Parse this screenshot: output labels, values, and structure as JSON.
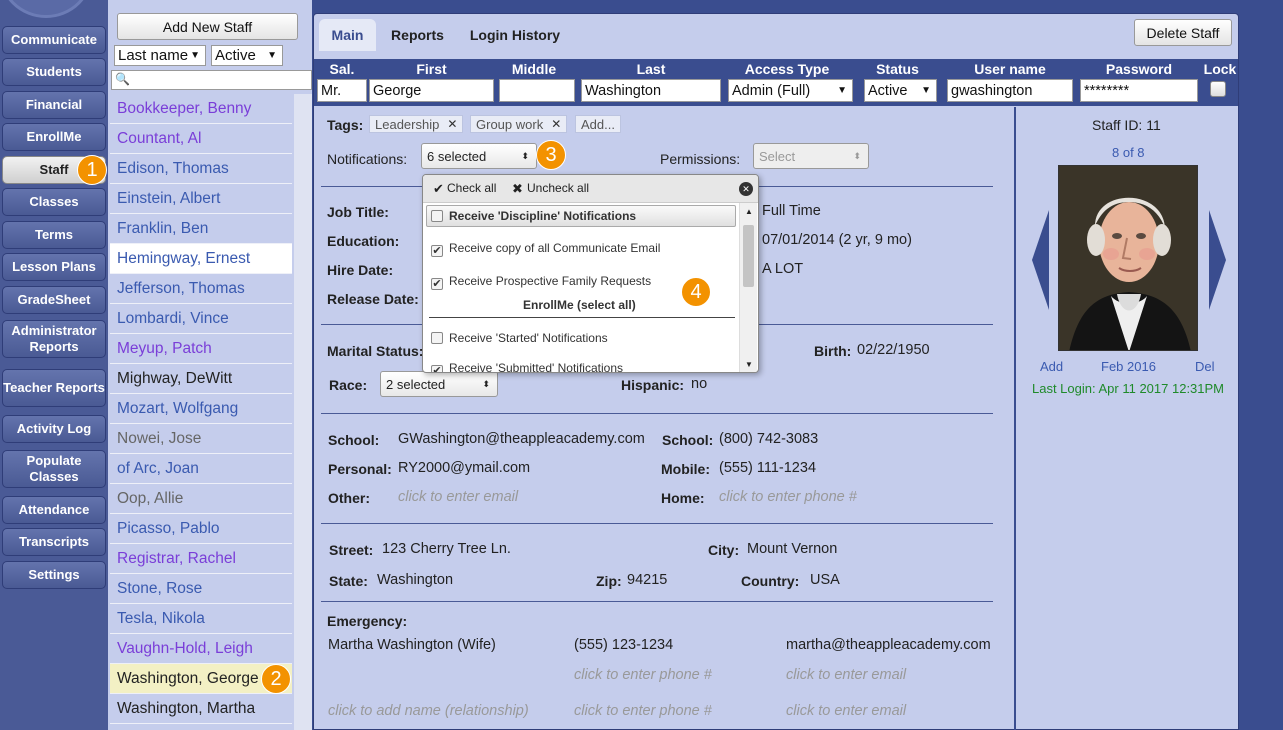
{
  "nav": {
    "items": [
      {
        "label": "Communicate"
      },
      {
        "label": "Students"
      },
      {
        "label": "Financial"
      },
      {
        "label": "EnrollMe"
      },
      {
        "label": "Staff"
      },
      {
        "label": "Classes"
      },
      {
        "label": "Terms"
      },
      {
        "label": "Lesson Plans"
      },
      {
        "label": "GradeSheet"
      },
      {
        "label": "Administrator Reports"
      },
      {
        "label": "Teacher Reports"
      },
      {
        "label": "Activity Log"
      },
      {
        "label": "Populate Classes"
      },
      {
        "label": "Attendance"
      },
      {
        "label": "Transcripts"
      },
      {
        "label": "Settings"
      }
    ],
    "active": "Staff"
  },
  "badges": {
    "b1": "1",
    "b2": "2",
    "b3": "3",
    "b4": "4"
  },
  "stafflist": {
    "add_label": "Add New Staff",
    "sort_value": "Last name",
    "status_value": "Active",
    "search_placeholder": "",
    "items": [
      {
        "name": "Bookkeeper, Benny"
      },
      {
        "name": "Countant, Al"
      },
      {
        "name": "Edison, Thomas"
      },
      {
        "name": "Einstein, Albert"
      },
      {
        "name": "Franklin, Ben"
      },
      {
        "name": "Hemingway, Ernest"
      },
      {
        "name": "Jefferson, Thomas"
      },
      {
        "name": "Lombardi, Vince"
      },
      {
        "name": "Meyup, Patch"
      },
      {
        "name": "Mighway, DeWitt"
      },
      {
        "name": "Mozart, Wolfgang"
      },
      {
        "name": "Nowei, Jose"
      },
      {
        "name": "of Arc, Joan"
      },
      {
        "name": "Oop, Allie"
      },
      {
        "name": "Picasso, Pablo"
      },
      {
        "name": "Registrar, Rachel"
      },
      {
        "name": "Stone, Rose"
      },
      {
        "name": "Tesla, Nikola"
      },
      {
        "name": "Vaughn-Hold, Leigh"
      },
      {
        "name": "Washington, George"
      },
      {
        "name": "Washington, Martha"
      }
    ]
  },
  "tabs": {
    "main": "Main",
    "reports": "Reports",
    "login_history": "Login History"
  },
  "delete_label": "Delete Staff",
  "header": {
    "sal_label": "Sal.",
    "first_label": "First",
    "middle_label": "Middle",
    "last_label": "Last",
    "access_label": "Access Type",
    "status_label": "Status",
    "username_label": "User name",
    "password_label": "Password",
    "lock_label": "Lock",
    "sal": "Mr.",
    "first": "George",
    "middle": "",
    "last": "Washington",
    "access": "Admin (Full)",
    "status": "Active",
    "username": "gwashington",
    "password": "********"
  },
  "tags": {
    "label": "Tags:",
    "items": [
      "Leadership",
      "Group work"
    ],
    "add": "Add..."
  },
  "notifications": {
    "label": "Notifications:",
    "value": "6 selected"
  },
  "permissions": {
    "label": "Permissions:",
    "value": "Select"
  },
  "dropdown": {
    "check_all": "Check all",
    "uncheck_all": "Uncheck all",
    "rows": [
      {
        "label": "Receive 'Discipline' Notifications"
      },
      {
        "label": "Receive copy of all Communicate Email"
      },
      {
        "label": "Receive Prospective Family Requests"
      },
      {
        "label": "EnrollMe (select all)"
      },
      {
        "label": "Receive 'Started' Notifications"
      },
      {
        "label": "Receive 'Submitted' Notifications"
      }
    ]
  },
  "job": {
    "job_title_label": "Job Title:",
    "education_label": "Education:",
    "hire_label": "Hire Date:",
    "release_label": "Release Date:",
    "employment": "Full Time",
    "tenure": "07/01/2014 (2 yr, 9 mo)",
    "extra": "A LOT"
  },
  "personal": {
    "marital_label": "Marital Status:",
    "birth_label": "Birth:",
    "birth": "02/22/1950",
    "race_label": "Race:",
    "race": "2 selected",
    "hispanic_label": "Hispanic:",
    "hispanic": "no"
  },
  "contact": {
    "school_email_label": "School:",
    "school_email": "GWashington@theappleacademy.com",
    "school_phone_label": "School:",
    "school_phone": "(800) 742-3083",
    "personal_label": "Personal:",
    "personal_email": "RY2000@ymail.com",
    "mobile_label": "Mobile:",
    "mobile": "(555) 111-1234",
    "other_label": "Other:",
    "other_ph": "click to enter email",
    "home_label": "Home:",
    "home_ph": "click to enter phone #"
  },
  "address": {
    "street_label": "Street:",
    "street": "123 Cherry Tree Ln.",
    "city_label": "City:",
    "city": "Mount Vernon",
    "state_label": "State:",
    "state": "Washington",
    "zip_label": "Zip:",
    "zip": "94215",
    "country_label": "Country:",
    "country": "USA"
  },
  "emergency": {
    "label": "Emergency:",
    "name": "Martha Washington (Wife)",
    "phone": "(555) 123-1234",
    "email": "martha@theappleacademy.com",
    "phone_ph": "click to enter phone #",
    "email_ph": "click to enter email",
    "name_ph": "click to add name (relationship)"
  },
  "profile": {
    "staff_id": "Staff ID: 11",
    "position": "8 of 8",
    "add": "Add",
    "date": "Feb 2016",
    "del": "Del",
    "last_login": "Last Login: Apr 11 2017 12:31PM"
  },
  "colors": {
    "accent": "#3a4d8f",
    "panel": "#c5cdec",
    "badge": "#f39200",
    "login": "#1f8a2a",
    "purple_name": "#7a3ed8"
  }
}
